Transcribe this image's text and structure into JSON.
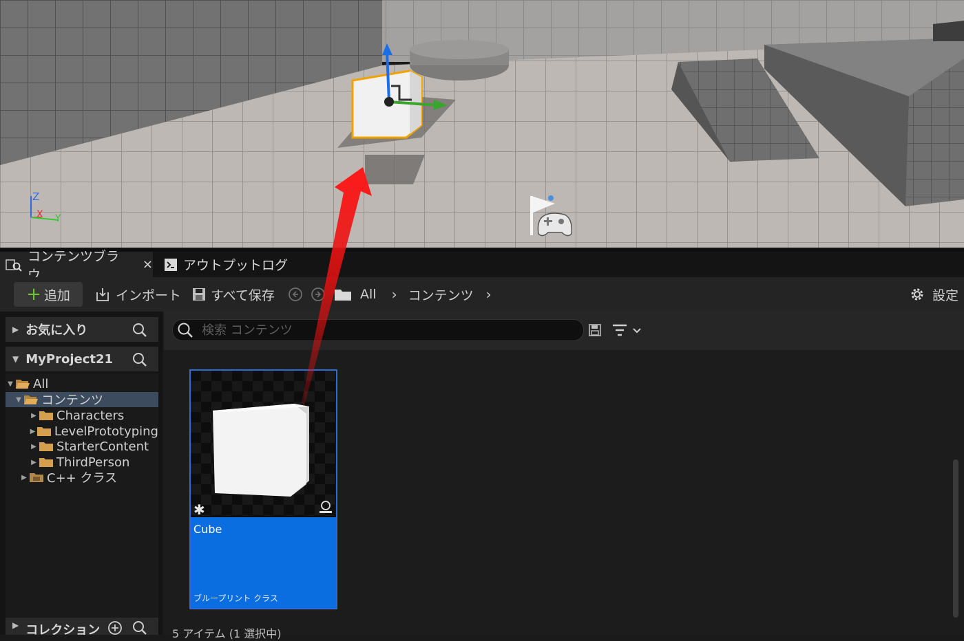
{
  "viewport": {
    "axis_labels": {
      "z": "Z",
      "x": "X",
      "y": "Y"
    }
  },
  "tabs": [
    {
      "label": "コンテンツブラウ...",
      "close": "×",
      "active": true,
      "icon": "content-browser-icon"
    },
    {
      "label": "アウトプットログ",
      "active": false,
      "icon": "output-log-icon"
    }
  ],
  "toolbar": {
    "add_label": "追加",
    "import_label": "インポート",
    "save_all_label": "すべて保存",
    "breadcrumb": [
      "All",
      "コンテンツ"
    ],
    "settings_label": "設定"
  },
  "left_panel": {
    "favorites_label": "お気に入り",
    "project_label": "MyProject21",
    "tree": [
      {
        "label": "All",
        "expanded": true,
        "depth": 0
      },
      {
        "label": "コンテンツ",
        "expanded": true,
        "depth": 1,
        "selected": true
      },
      {
        "label": "Characters",
        "expanded": false,
        "depth": 2
      },
      {
        "label": "LevelPrototyping",
        "expanded": false,
        "depth": 2
      },
      {
        "label": "StarterContent",
        "expanded": false,
        "depth": 2
      },
      {
        "label": "ThirdPerson",
        "expanded": false,
        "depth": 2
      },
      {
        "label": "C++ クラス",
        "expanded": false,
        "depth": 1
      }
    ],
    "collections_label": "コレクション"
  },
  "main": {
    "search_placeholder": "検索 コンテンツ",
    "asset": {
      "name": "Cube",
      "type": "ブループリント クラス"
    },
    "status": "5 アイテム (1 選択中)"
  },
  "colors": {
    "accent": "#0a6ee0",
    "add_plus": "#6fbf3a",
    "annotation_arrow": "#e01010"
  }
}
